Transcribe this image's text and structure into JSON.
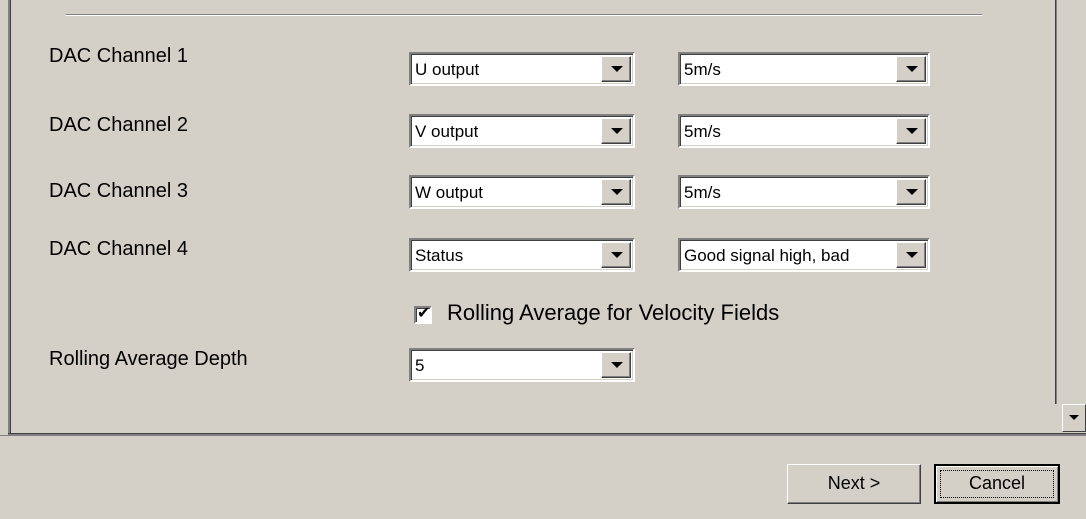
{
  "dac_channels": [
    {
      "label": "DAC Channel 1",
      "output": "U output",
      "range": "5m/s"
    },
    {
      "label": "DAC Channel 2",
      "output": "V output",
      "range": "5m/s"
    },
    {
      "label": "DAC Channel 3",
      "output": "W output",
      "range": "5m/s"
    },
    {
      "label": "DAC Channel 4",
      "output": "Status",
      "range": "Good signal high, bad"
    }
  ],
  "rolling_average": {
    "checkbox_label": "Rolling Average for Velocity Fields",
    "checked": true,
    "depth_label": "Rolling Average Depth",
    "depth_value": "5"
  },
  "footer": {
    "next_label": "Next >",
    "cancel_label": "Cancel"
  }
}
